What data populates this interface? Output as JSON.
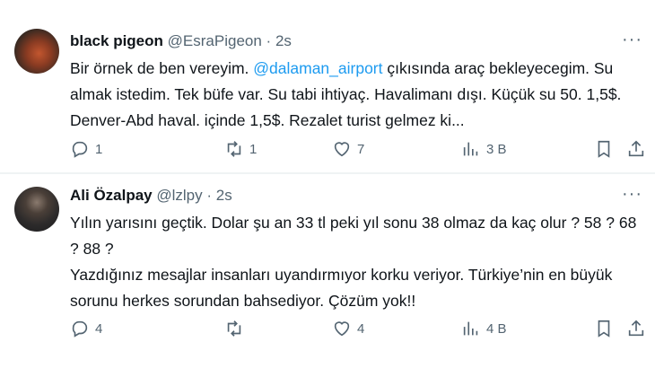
{
  "tweets": [
    {
      "name": "black pigeon",
      "handle": "@EsraPigeon",
      "separator": "·",
      "time": "2s",
      "text_parts": [
        "Bir örnek de ben vereyim. ",
        "@dalaman_airport",
        " çıkısında araç bekleyecegim. Su almak istedim. Tek büfe var. Su tabi ihtiyaç. Havalimanı dışı. Küçük su 50. 1,5$. Denver-Abd haval. içinde 1,5$. Rezalet turist gelmez ki..."
      ],
      "replies": "1",
      "retweets": "1",
      "likes": "7",
      "views": "3 B"
    },
    {
      "name": "Ali Özalpay",
      "handle": "@lzlpy",
      "separator": "·",
      "time": "2s",
      "text_lines": [
        "Yılın yarısını geçtik. Dolar şu an 33 tl peki yıl sonu 38 olmaz da kaç olur ? 58 ? 68 ? 88 ?",
        "Yazdığınız mesajlar insanları uyandırmıyor korku veriyor. Türkiye’nin en büyük sorunu herkes sorundan bahsediyor. Çözüm yok!!"
      ],
      "replies": "4",
      "retweets": "",
      "likes": "4",
      "views": "4 B"
    }
  ],
  "icons": {
    "more": "more-icon",
    "reply": "reply-icon",
    "retweet": "retweet-icon",
    "like": "heart-icon",
    "views": "views-icon",
    "bookmark": "bookmark-icon",
    "share": "share-icon"
  },
  "colors": {
    "text": "#0f1419",
    "secondary": "#536471",
    "link": "#1d9bf0",
    "divider": "#eff3f4"
  }
}
